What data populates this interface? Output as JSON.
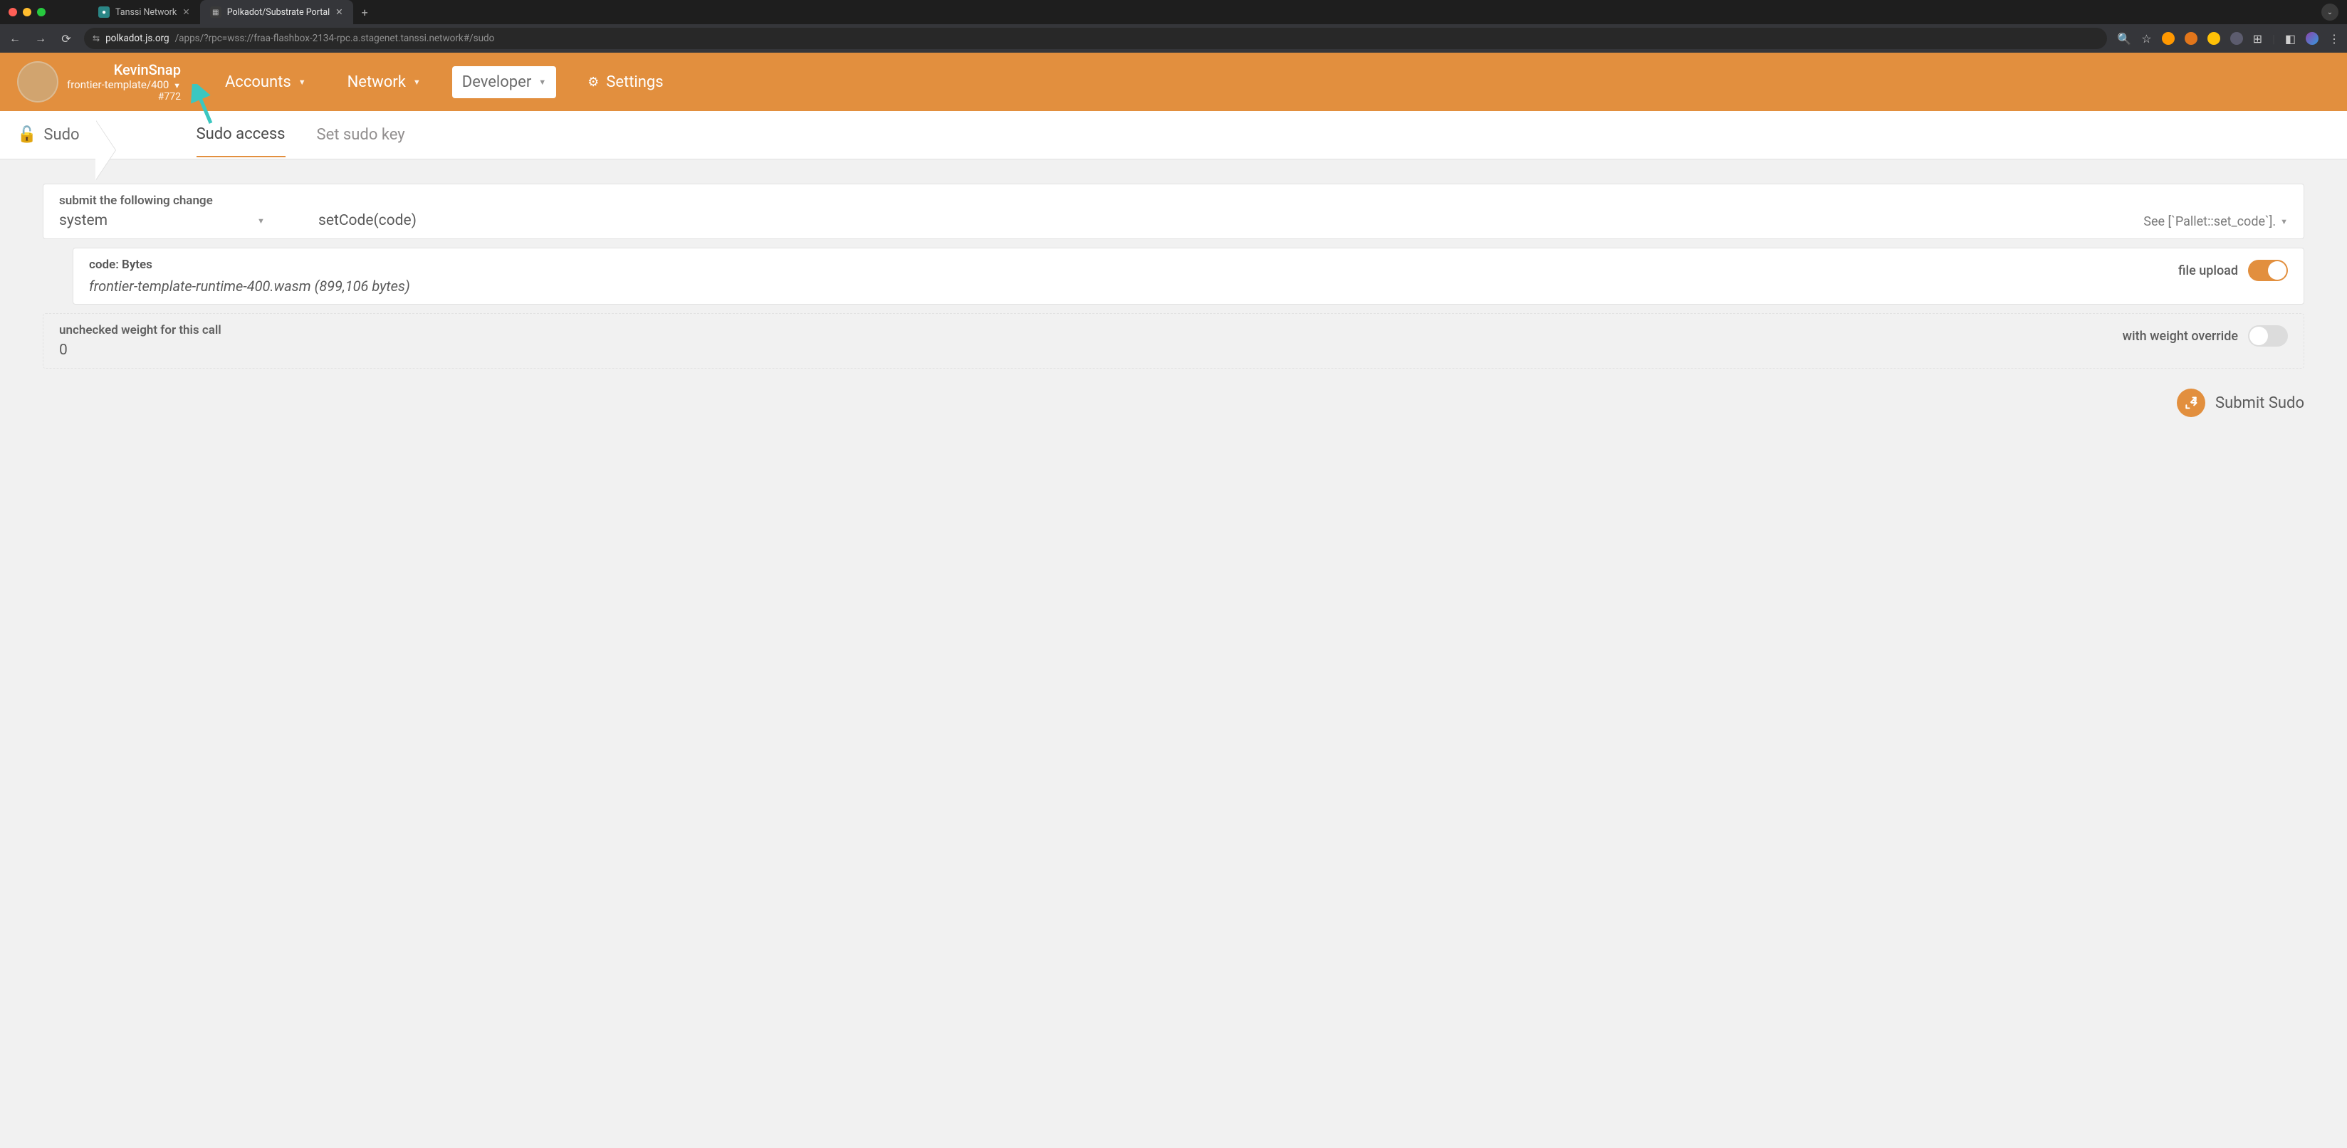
{
  "browser": {
    "tabs": [
      {
        "title": "Tanssi Network",
        "active": false
      },
      {
        "title": "Polkadot/Substrate Portal",
        "active": true
      }
    ],
    "url_host": "polkadot.js.org",
    "url_path": "/apps/?rpc=wss://fraa-flashbox-2134-rpc.a.stagenet.tanssi.network#/sudo"
  },
  "chain": {
    "name": "KevinSnap",
    "spec": "frontier-template/400",
    "block": "#772"
  },
  "nav": {
    "accounts": "Accounts",
    "network": "Network",
    "developer": "Developer",
    "settings": "Settings"
  },
  "subnav": {
    "section": "Sudo",
    "tab_access": "Sudo access",
    "tab_setkey": "Set sudo key"
  },
  "form": {
    "submit_change_label": "submit the following change",
    "pallet": "system",
    "method": "setCode(code)",
    "docs": "See [`Pallet::set_code`].",
    "param_label": "code: Bytes",
    "file_value": "frontier-template-runtime-400.wasm (899,106 bytes)",
    "file_upload_label": "file upload",
    "weight_label": "unchecked weight for this call",
    "weight_value": "0",
    "weight_override_label": "with weight override"
  },
  "submit": {
    "label": "Submit Sudo"
  }
}
